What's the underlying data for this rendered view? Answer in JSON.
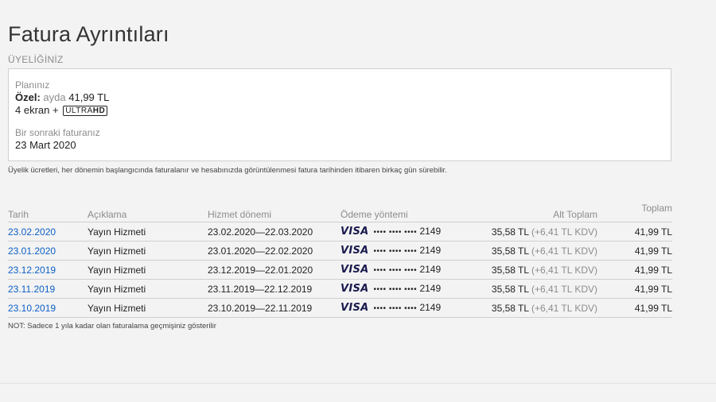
{
  "page": {
    "title": "Fatura Ayrıntıları",
    "membership_label": "ÜYELİĞİNİZ"
  },
  "plan": {
    "plan_label": "Planınız",
    "plan_name": "Özel:",
    "per_month": "ayda",
    "price": "41,99 TL",
    "screens": "4 ekran +",
    "badge_ultra": "ULTRA",
    "badge_hd": "HD",
    "next_bill_label": "Bir sonraki faturanız",
    "next_bill_date": "23 Mart 2020"
  },
  "note_top": "Üyelik ücretleri, her dönemin başlangıcında faturalanır ve hesabınızda görüntülenmesi fatura tarihinden itibaren birkaç gün sürebilir.",
  "table": {
    "headers": {
      "date": "Tarih",
      "description": "Açıklama",
      "service_period": "Hizmet dönemi",
      "payment_method": "Ödeme yöntemi",
      "subtotal": "Alt Toplam",
      "total": "Toplam"
    },
    "rows": [
      {
        "date": "23.02.2020",
        "description": "Yayın Hizmeti",
        "period": "23.02.2020—22.03.2020",
        "card_brand": "VISA",
        "card_mask": "•••• •••• ••••",
        "card_last4": "2149",
        "subtotal": "35,58 TL",
        "tax": "(+6,41 TL KDV)",
        "total": "41,99 TL"
      },
      {
        "date": "23.01.2020",
        "description": "Yayın Hizmeti",
        "period": "23.01.2020—22.02.2020",
        "card_brand": "VISA",
        "card_mask": "•••• •••• ••••",
        "card_last4": "2149",
        "subtotal": "35,58 TL",
        "tax": "(+6,41 TL KDV)",
        "total": "41,99 TL"
      },
      {
        "date": "23.12.2019",
        "description": "Yayın Hizmeti",
        "period": "23.12.2019—22.01.2020",
        "card_brand": "VISA",
        "card_mask": "•••• •••• ••••",
        "card_last4": "2149",
        "subtotal": "35,58 TL",
        "tax": "(+6,41 TL KDV)",
        "total": "41,99 TL"
      },
      {
        "date": "23.11.2019",
        "description": "Yayın Hizmeti",
        "period": "23.11.2019—22.12.2019",
        "card_brand": "VISA",
        "card_mask": "•••• •••• ••••",
        "card_last4": "2149",
        "subtotal": "35,58 TL",
        "tax": "(+6,41 TL KDV)",
        "total": "41,99 TL"
      },
      {
        "date": "23.10.2019",
        "description": "Yayın Hizmeti",
        "period": "23.10.2019—22.11.2019",
        "card_brand": "VISA",
        "card_mask": "•••• •••• ••••",
        "card_last4": "2149",
        "subtotal": "35,58 TL",
        "tax": "(+6,41 TL KDV)",
        "total": "41,99 TL"
      }
    ]
  },
  "note_bottom": "NOT: Sadece 1 yıla kadar olan faturalama geçmişiniz gösterilir",
  "colors": {
    "link": "#0c5fc6",
    "background": "#f3f3f3",
    "muted": "#8c8c8c"
  }
}
